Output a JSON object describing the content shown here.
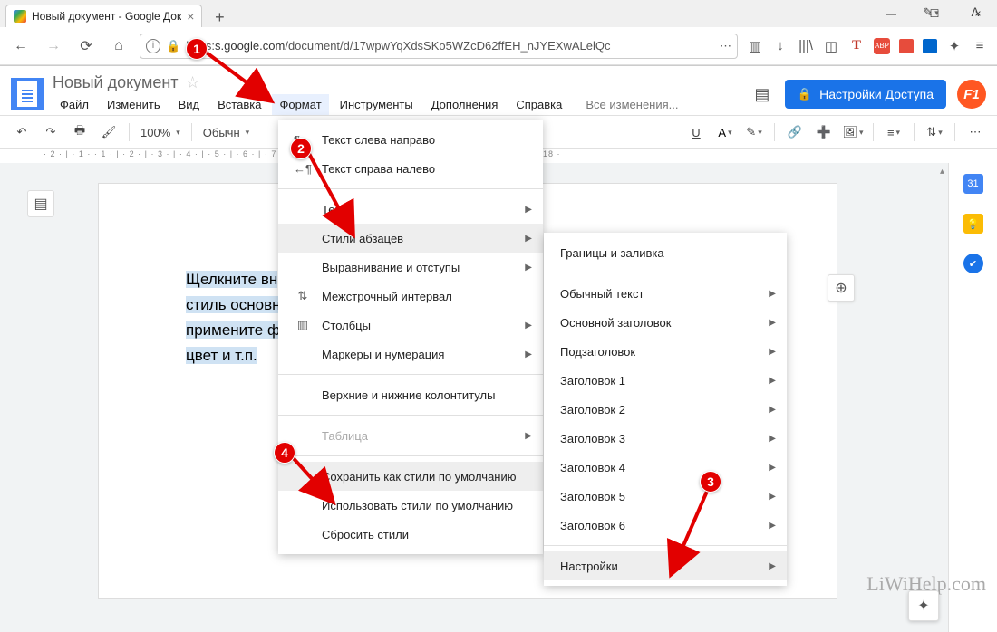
{
  "browser": {
    "tab_title": "Новый документ - Google Док",
    "url_prefix": "https",
    "url_host": "s.google.com",
    "url_path": "/document/d/17wpwYqXdsSKo5WZcD62ffEH_nJYEXwALelQc"
  },
  "doc": {
    "title": "Новый документ",
    "share_label": "Настройки Доступа",
    "changes_label": "Все изменения...",
    "menu": {
      "file": "Файл",
      "edit": "Изменить",
      "view": "Вид",
      "insert": "Вставка",
      "format": "Формат",
      "tools": "Инструменты",
      "addons": "Дополнения",
      "help": "Справка"
    }
  },
  "toolbar": {
    "zoom": "100%",
    "style": "Обычн",
    "ruler": "· 2 · | · 1 ·   · 1 · | · 2 · | · 3 · | · 4 · | · 5 · | · 6 · | · 7 ·                                             · | · 11 · | · 12 · | · 13 · | · 14 · | · 15 · | · 16 · | · 17 · | · 18 ·"
  },
  "page_text": {
    "l1": "Щелкните вн",
    "l2": "стиль основн",
    "l3": "примените ф",
    "l4": "цвет и т.п."
  },
  "format_menu": {
    "ltr": "Текст слева направо",
    "rtl": "Текст справа налево",
    "text": "Текст",
    "para_styles": "Стили абзацев",
    "align": "Выравнивание и отступы",
    "line_spacing": "Межстрочный интервал",
    "columns": "Столбцы",
    "bullets": "Маркеры и нумерация",
    "headers": "Верхние и нижние колонтитулы",
    "table": "Таблица",
    "save_default": "Сохранить как стили по умолчанию",
    "use_default": "Использовать стили по умолчанию",
    "reset": "Сбросить стили"
  },
  "styles_submenu": {
    "borders": "Границы и заливка",
    "normal": "Обычный текст",
    "title": "Основной заголовок",
    "subtitle": "Подзаголовок",
    "h1": "Заголовок 1",
    "h2": "Заголовок 2",
    "h3": "Заголовок 3",
    "h4": "Заголовок 4",
    "h5": "Заголовок 5",
    "h6": "Заголовок 6",
    "settings": "Настройки"
  },
  "markers": {
    "m1": "1",
    "m2": "2",
    "m3": "3",
    "m4": "4"
  },
  "watermark": "LiWiHelp.com",
  "side": {
    "cal": "31"
  }
}
